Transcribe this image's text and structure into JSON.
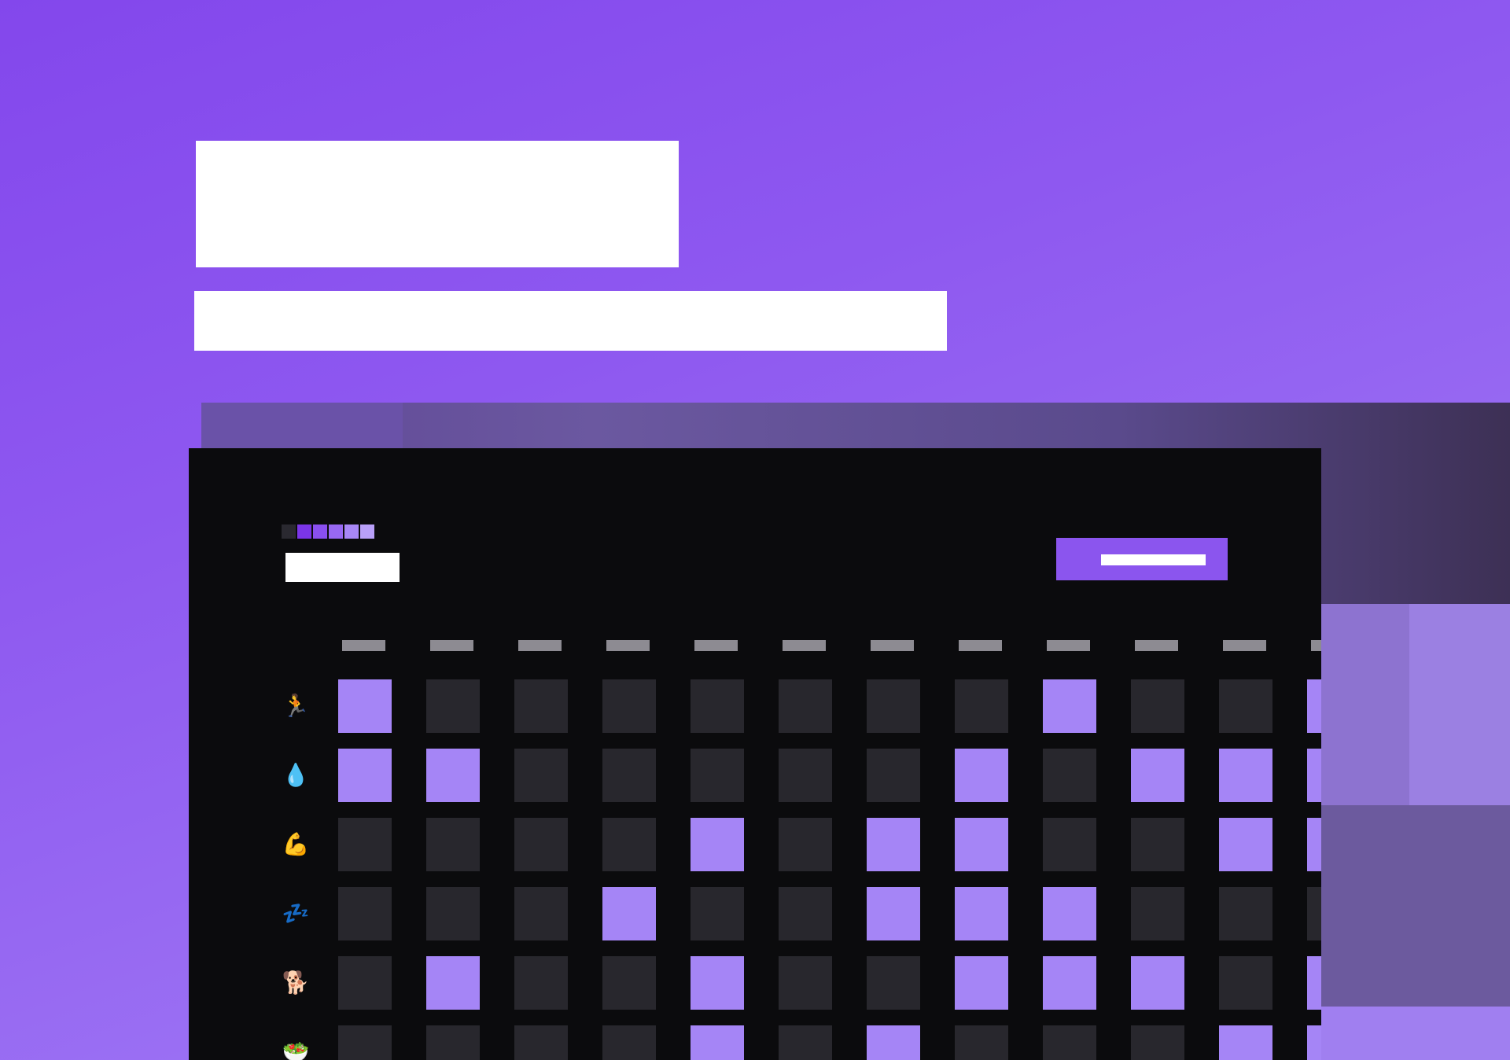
{
  "hero": {
    "title": "",
    "subtitle": ""
  },
  "legend": {
    "colors": [
      "#2a2930",
      "#7b35e8",
      "#8a4ff0",
      "#9868f2",
      "#a887f6",
      "#b9a0f8"
    ]
  },
  "header": {
    "month_label": "",
    "add_habit_label": ""
  },
  "grid": {
    "days": [
      "",
      "",
      "",
      "",
      "",
      "",
      "",
      "",
      "",
      "",
      "",
      ""
    ],
    "on_color": "#a585f6",
    "off_color": "#28272d",
    "habits": [
      {
        "icon": "🏃",
        "icon_name": "running-icon",
        "days": [
          1,
          0,
          0,
          0,
          0,
          0,
          0,
          0,
          1,
          0,
          0,
          1
        ]
      },
      {
        "icon": "💧",
        "icon_name": "water-drop-icon",
        "days": [
          1,
          1,
          0,
          0,
          0,
          0,
          0,
          1,
          0,
          1,
          1,
          1
        ]
      },
      {
        "icon": "💪",
        "icon_name": "flexed-biceps-icon",
        "days": [
          0,
          0,
          0,
          0,
          1,
          0,
          1,
          1,
          0,
          0,
          1,
          1
        ]
      },
      {
        "icon": "💤",
        "icon_name": "sleep-zzz-icon",
        "days": [
          0,
          0,
          0,
          1,
          0,
          0,
          1,
          1,
          1,
          0,
          0,
          0
        ]
      },
      {
        "icon": "🐕",
        "icon_name": "dog-walk-icon",
        "days": [
          0,
          1,
          0,
          0,
          1,
          0,
          0,
          1,
          1,
          1,
          0,
          1
        ]
      },
      {
        "icon": "🥗",
        "icon_name": "salad-icon",
        "days": [
          0,
          0,
          0,
          0,
          1,
          0,
          1,
          0,
          0,
          0,
          1,
          1
        ]
      }
    ]
  }
}
